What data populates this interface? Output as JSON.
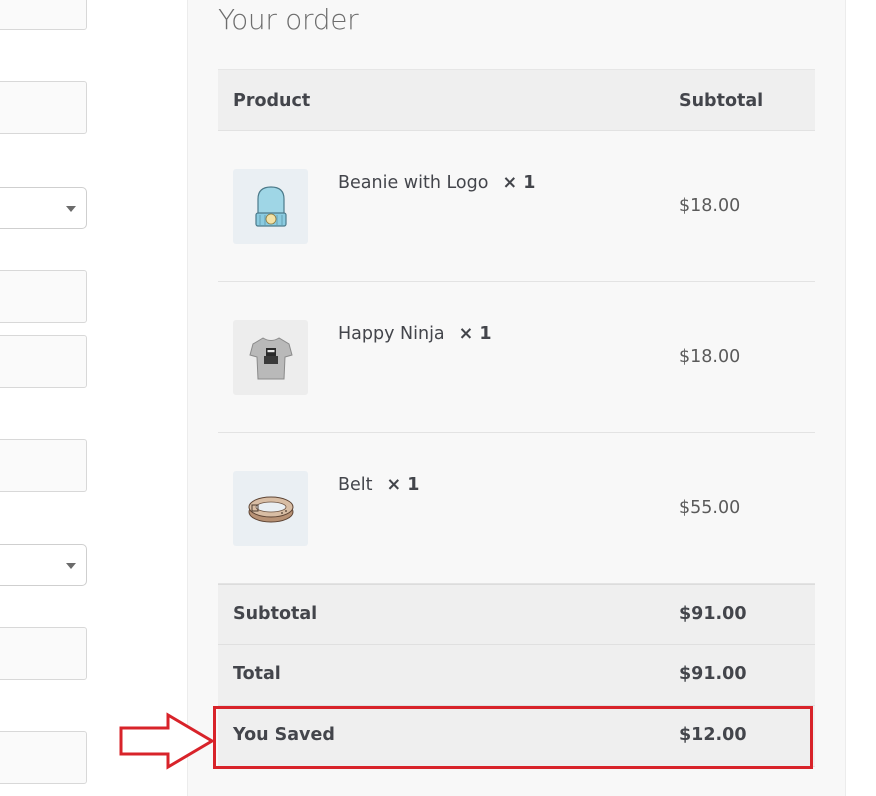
{
  "order": {
    "title": "Your order",
    "columns": {
      "product": "Product",
      "subtotal": "Subtotal"
    },
    "items": [
      {
        "name": "Beanie with Logo",
        "qty": "× 1",
        "price": "$18.00",
        "thumb": "beanie-image"
      },
      {
        "name": "Happy Ninja",
        "qty": "× 1",
        "price": "$18.00",
        "thumb": "tshirt-image"
      },
      {
        "name": "Belt",
        "qty": "× 1",
        "price": "$55.00",
        "thumb": "belt-image"
      }
    ],
    "totals": {
      "subtotal_label": "Subtotal",
      "subtotal_value": "$91.00",
      "total_label": "Total",
      "total_value": "$91.00",
      "saved_label": "You Saved",
      "saved_value": "$12.00"
    }
  },
  "annotation": {
    "highlight_color": "#d8232a",
    "arrow_color": "#d8232a"
  }
}
